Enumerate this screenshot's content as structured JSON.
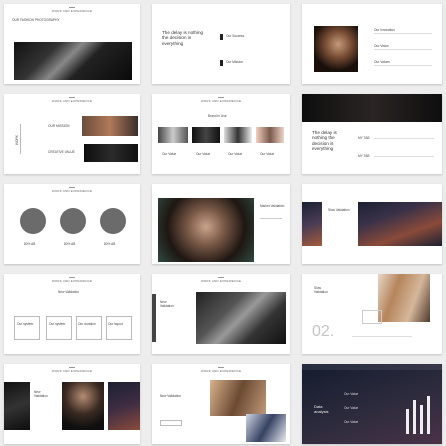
{
  "slides": [
    {
      "header": "WORK AND EXPERIENCE",
      "title": "OUR FASHION PHOTOGRAPHY"
    },
    {
      "header": "",
      "quote": "The delay is nothing the decision is everything",
      "items": [
        "Our Success",
        "Our Mission"
      ]
    },
    {
      "header": "",
      "items": [
        "Our Innovation",
        "Our Vision",
        "Our Values"
      ]
    },
    {
      "header": "WORK AND EXPERIENCE",
      "items": [
        "OUR MISSION",
        "CREATIVE VALUE"
      ],
      "side": "WORK"
    },
    {
      "header": "WORK AND EXPERIENCE",
      "title": "Brand In Use",
      "captions": [
        "Our Value",
        "Our Value",
        "Our Value",
        "Our Value"
      ]
    },
    {
      "header": "",
      "quote": "The delay is nothing the decision is everything",
      "years": [
        "MY TAB",
        "MY TAB"
      ]
    },
    {
      "header": "WORK AND EXPERIENCE",
      "stats": [
        "80% AB",
        "80% AB",
        "80% AB"
      ]
    },
    {
      "header": "",
      "title": "Market Validation"
    },
    {
      "header": "",
      "title": "Slow Validation"
    },
    {
      "header": "WORK AND EXPERIENCE",
      "title": "New Validation",
      "boxes": [
        "Our system",
        "Our system",
        "Our duration",
        "Our layout"
      ]
    },
    {
      "header": "WORK AND EXPERIENCE",
      "title": "New Validation"
    },
    {
      "header": "",
      "title": "Slow Validation",
      "number": "02."
    },
    {
      "header": "WORK AND EXPERIENCE",
      "title": "New Validation"
    },
    {
      "header": "WORK AND EXPERIENCE",
      "title": "New Validation"
    },
    {
      "header": "WORK AND EXPERIENCE",
      "title": "Data analysis",
      "bars": [
        0.6,
        0.8,
        0.7,
        0.9
      ],
      "bar_labels": [
        "Our Value",
        "Our Value",
        "Our Value"
      ]
    }
  ]
}
